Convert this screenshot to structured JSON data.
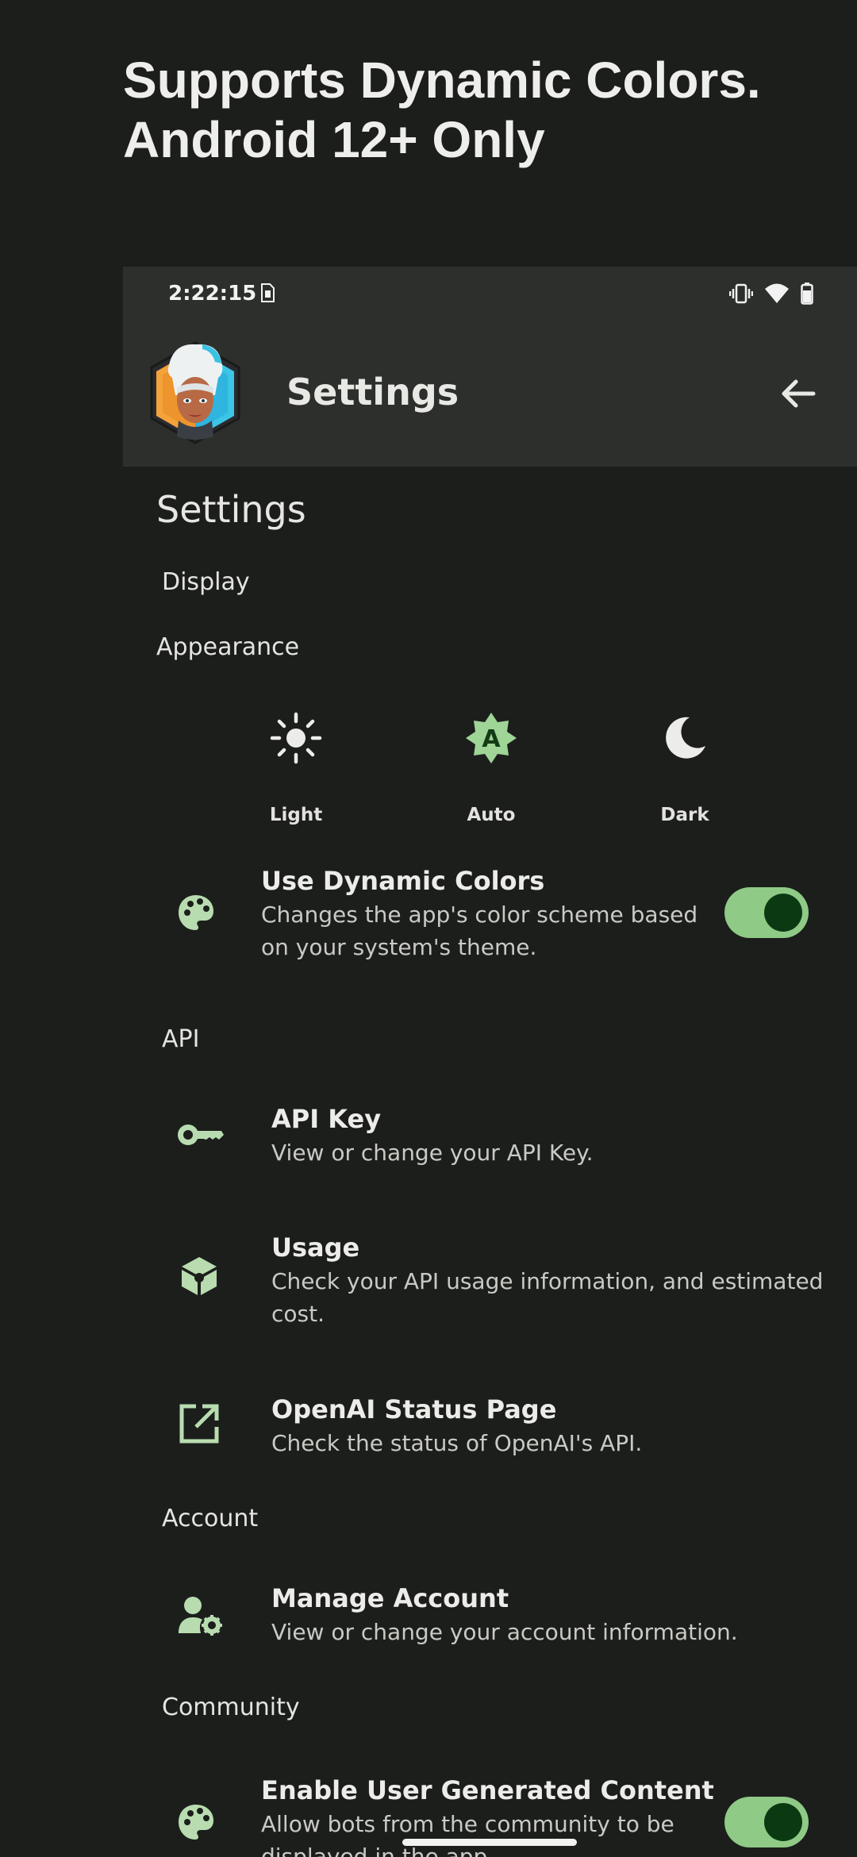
{
  "promo": {
    "line1": "Supports Dynamic Colors.",
    "line2": "Android 12+ Only"
  },
  "status_bar": {
    "time": "2:22:15",
    "icons": [
      "sim-card-icon",
      "vibrate-icon",
      "wifi-icon",
      "battery-icon"
    ]
  },
  "top_bar": {
    "title": "Settings",
    "logo": "app-avatar-logo",
    "back_icon": "arrow-back-icon",
    "background": "#2c2f2b"
  },
  "page_heading": "Settings",
  "sections": {
    "display": "Display",
    "appearance": "Appearance",
    "api": "API",
    "account": "Account",
    "community": "Community"
  },
  "theme_options": [
    {
      "label": "Light",
      "icon": "sun-icon",
      "selected": false
    },
    {
      "label": "Auto",
      "icon": "auto-brightness-icon",
      "selected": true
    },
    {
      "label": "Dark",
      "icon": "moon-icon",
      "selected": false
    }
  ],
  "items": {
    "dynamic_colors": {
      "title": "Use Dynamic Colors",
      "desc_line1": "Changes the app's color scheme based",
      "desc_line2": "on your system's theme.",
      "icon": "palette-icon",
      "enabled": true
    },
    "api_key": {
      "title": "API Key",
      "desc": "View or change your API Key.",
      "icon": "key-icon"
    },
    "usage": {
      "title": "Usage",
      "desc_line1": "Check your API usage information, and estimated",
      "desc_line2": "cost.",
      "icon": "cube-icon"
    },
    "status_page": {
      "title": "OpenAI Status Page",
      "desc": "Check the status of OpenAI's API.",
      "icon": "open-in-new-icon"
    },
    "manage_account": {
      "title": "Manage Account",
      "desc": "View or change your account information.",
      "icon": "manage-account-icon"
    },
    "user_content": {
      "title": "Enable User Generated Content",
      "desc_line1": "Allow bots from the community to be",
      "desc_line2": "displayed in the app.",
      "icon": "palette-icon",
      "enabled": true
    }
  },
  "colors": {
    "background": "#1c1e1c",
    "accent": "#8fca86",
    "accent_dark": "#0b3a12",
    "icon_tint": "#b8dcb0"
  }
}
